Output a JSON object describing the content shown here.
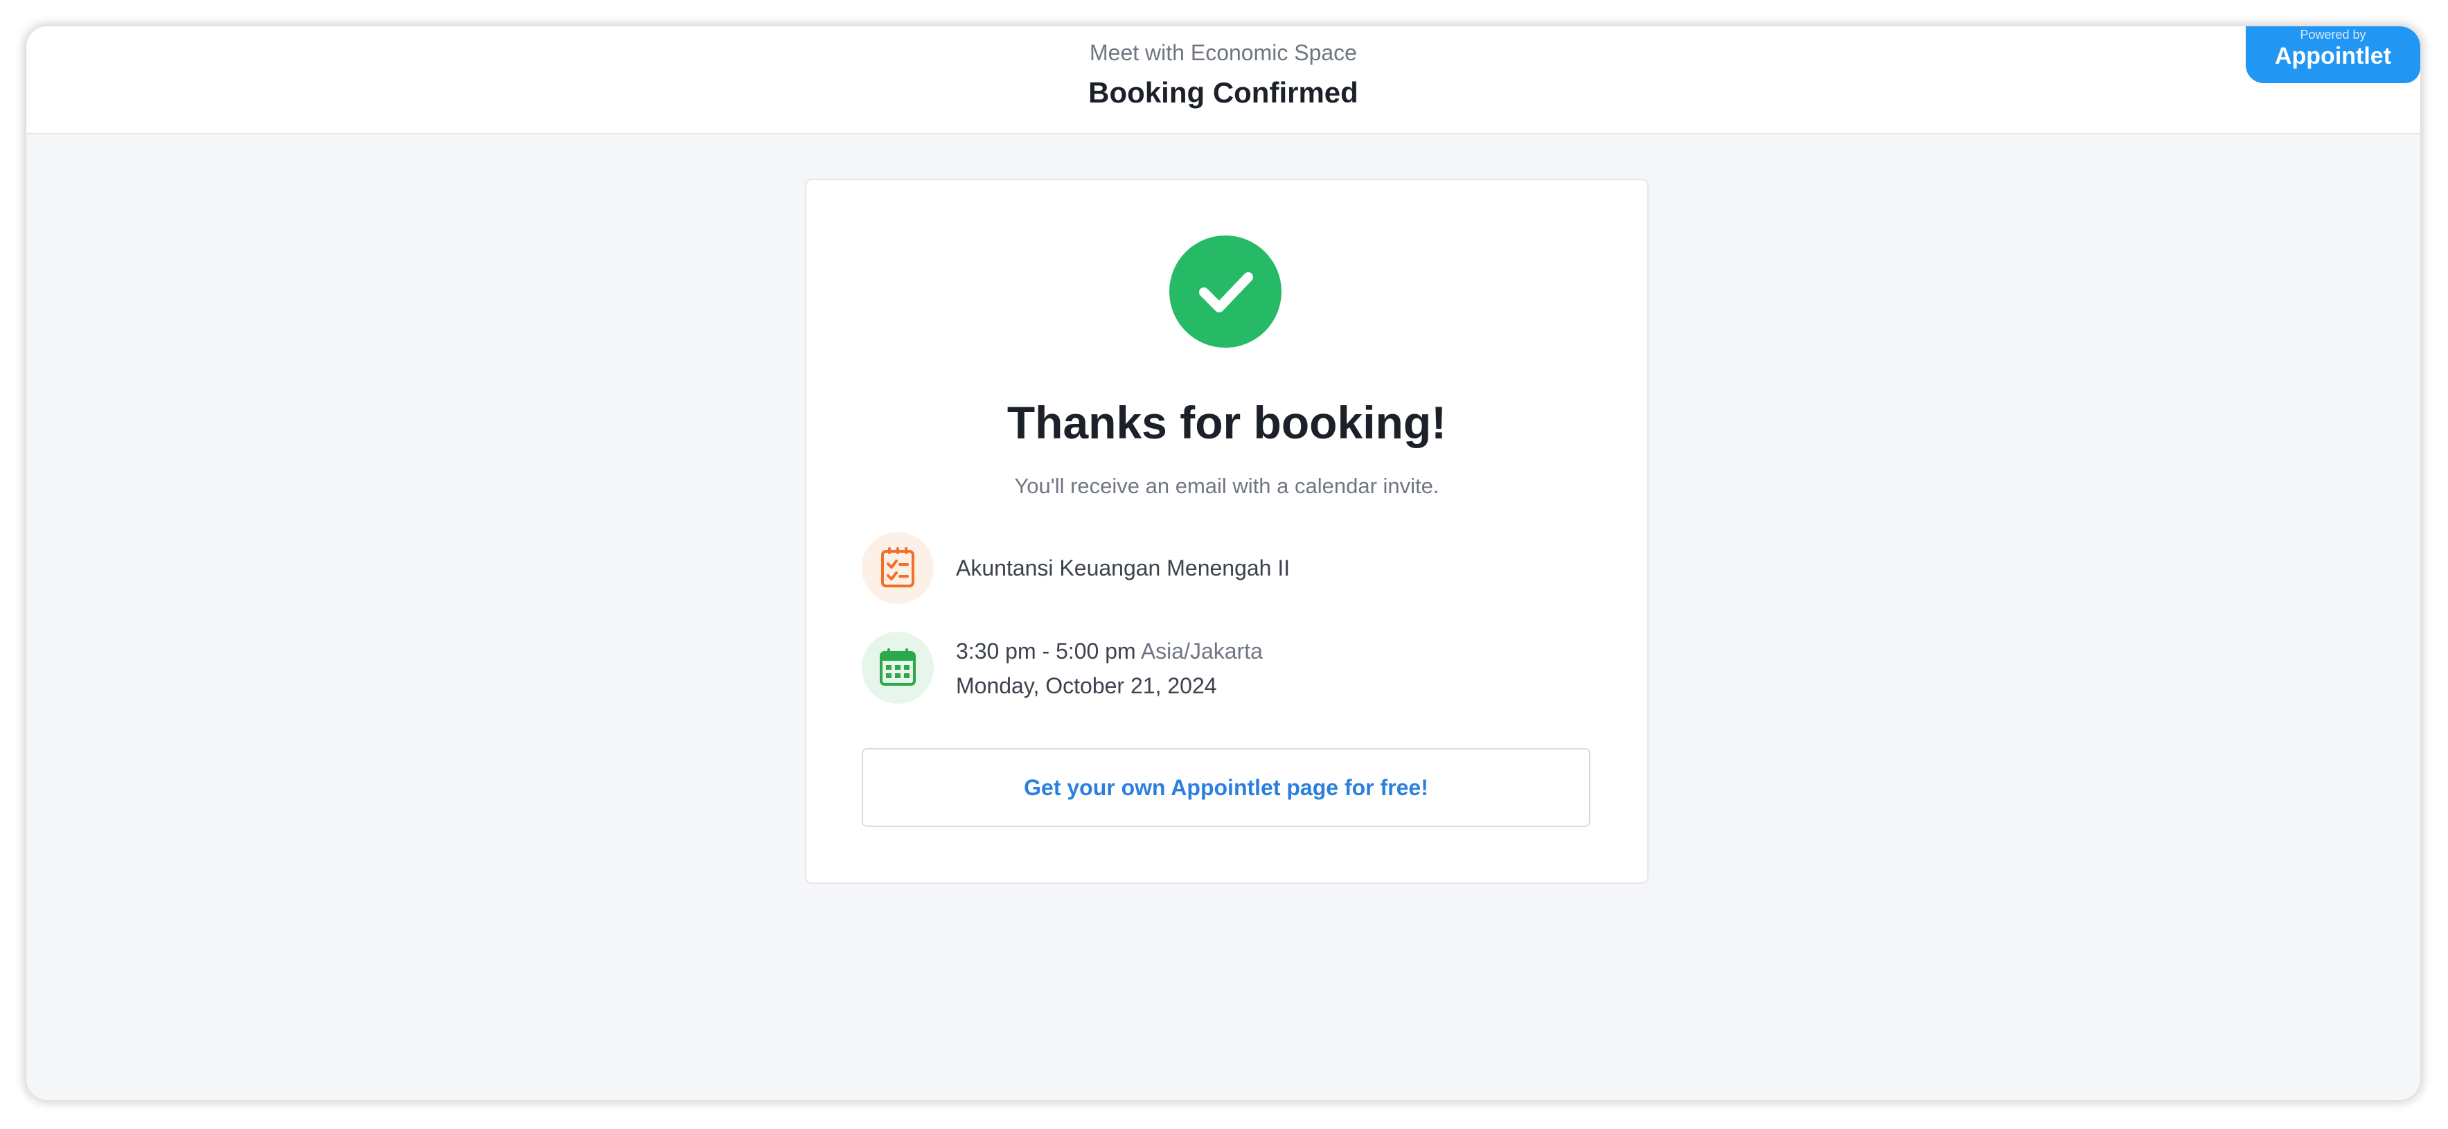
{
  "header": {
    "subtitle": "Meet with Economic Space",
    "title": "Booking Confirmed"
  },
  "badge": {
    "small": "Powered by",
    "brand": "Appointlet"
  },
  "card": {
    "success_icon": "check-circle-icon",
    "heading": "Thanks for booking!",
    "note": "You'll receive an email with a calendar invite.",
    "event": {
      "icon": "clipboard-icon",
      "name": "Akuntansi Keuangan Menengah II"
    },
    "schedule": {
      "icon": "calendar-icon",
      "time": "3:30 pm - 5:00 pm",
      "timezone": "Asia/Jakarta",
      "date": "Monday, October 21, 2024"
    },
    "cta_label": "Get your own Appointlet page for free!"
  },
  "colors": {
    "success": "#27ba66",
    "accent": "#2196f3",
    "link": "#2b7fe0",
    "event_icon": "#f0702a",
    "calendar_icon": "#2aa84a"
  }
}
